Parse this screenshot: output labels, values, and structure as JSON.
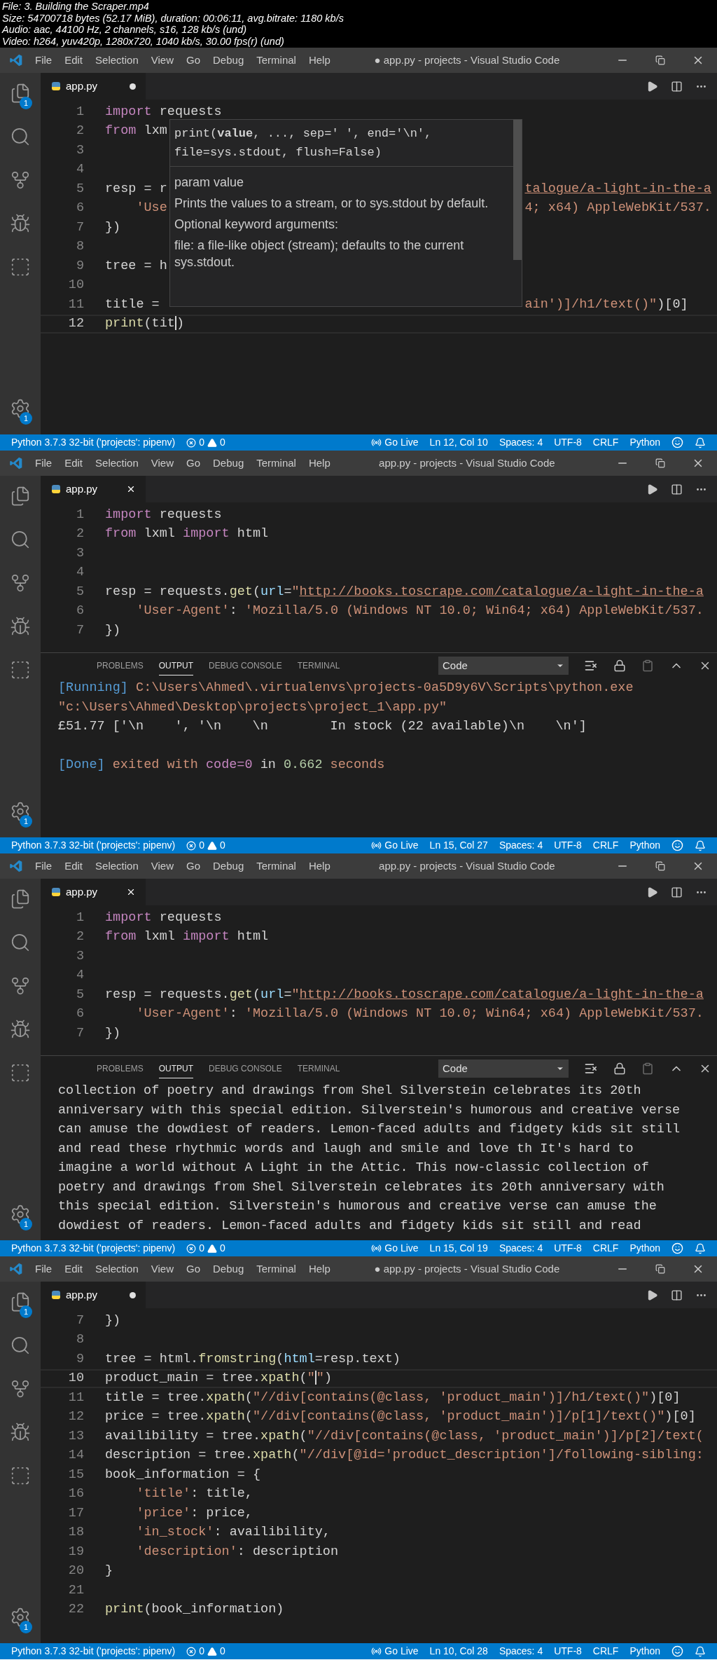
{
  "file_info": [
    "File: 3. Building the Scraper.mp4",
    "Size: 54700718 bytes (52.17 MiB), duration: 00:06:11, avg.bitrate: 1180 kb/s",
    "Audio: aac, 44100 Hz, 2 channels, s16, 128 kb/s (und)",
    "Video: h264, yuv420p, 1280x720, 1040 kb/s, 30.00 fps(r) (und)"
  ],
  "frames": [
    {
      "menu": [
        "File",
        "Edit",
        "Selection",
        "View",
        "Go",
        "Debug",
        "Terminal",
        "Help"
      ],
      "title": "● app.py - projects - Visual Studio Code",
      "explorer_badge": "1",
      "settings_badge": "1",
      "tab": {
        "label": "app.py",
        "dirty": true
      },
      "code": [
        {
          "number": "1",
          "current": false,
          "tokens": [
            {
              "text": "import",
              "kind": "kw"
            },
            {
              "text": " requests",
              "kind": "plain"
            }
          ]
        },
        {
          "number": "2",
          "current": false,
          "tokens": [
            {
              "text": "from",
              "kind": "kw"
            },
            {
              "text": " lxm",
              "kind": "plain"
            }
          ]
        },
        {
          "number": "3",
          "current": false
        },
        {
          "number": "4",
          "current": false
        },
        {
          "number": "5",
          "current": false,
          "tokens": [
            {
              "text": "resp = r",
              "kind": "plain"
            }
          ],
          "tail": [
            {
              "text": "talogue/a-light-in-the-a",
              "kind": "url"
            }
          ]
        },
        {
          "number": "6",
          "current": false,
          "tokens": [
            {
              "text": "    'Use",
              "kind": "str"
            }
          ],
          "tail": [
            {
              "text": "4; x64) AppleWebKit/537.",
              "kind": "str"
            }
          ]
        },
        {
          "number": "7",
          "current": false,
          "tokens": [
            {
              "text": "})",
              "kind": "plain"
            }
          ]
        },
        {
          "number": "8",
          "current": false
        },
        {
          "number": "9",
          "current": false,
          "tokens": [
            {
              "text": "tree = h",
              "kind": "plain"
            }
          ]
        },
        {
          "number": "10",
          "current": false
        },
        {
          "number": "11",
          "current": false,
          "tokens": [
            {
              "text": "title = ",
              "kind": "plain"
            }
          ],
          "tail": [
            {
              "text": "ain')]/h1/text()\"",
              "kind": "str"
            },
            {
              "text": ")[0]",
              "kind": "plain"
            }
          ]
        },
        {
          "number": "12",
          "current": true,
          "tokens": [
            {
              "text": "print",
              "kind": "fn"
            },
            {
              "text": "(tit",
              "kind": "plain"
            },
            {
              "kind": "cursor"
            },
            {
              "text": ")",
              "kind": "plain"
            }
          ]
        }
      ],
      "hover": {
        "signature": "print(**value**, ..., sep=' ', end='\\n', file=sys.stdout, flush=False)",
        "param": "param value",
        "description": [
          "Prints the values to a stream, or to sys.stdout by default.",
          "Optional keyword arguments:",
          "file:  a file-like object (stream); defaults to the current sys.stdout."
        ]
      },
      "status": {
        "interpreter": "Python 3.7.3 32-bit ('projects': pipenv)",
        "errors": "0",
        "warnings": "0",
        "go_live": "Go Live",
        "position": "Ln 12, Col 10",
        "spaces": "Spaces: 4",
        "encoding": "UTF-8",
        "eol": "CRLF",
        "language": "Python"
      }
    },
    {
      "menu": [
        "File",
        "Edit",
        "Selection",
        "View",
        "Go",
        "Debug",
        "Terminal",
        "Help"
      ],
      "title": "app.py - projects - Visual Studio Code",
      "settings_badge": "1",
      "tab": {
        "label": "app.py",
        "dirty": false
      },
      "code": [
        {
          "number": "1",
          "current": false,
          "tokens": [
            {
              "text": "import",
              "kind": "kw"
            },
            {
              "text": " requests",
              "kind": "plain"
            }
          ]
        },
        {
          "number": "2",
          "current": false,
          "tokens": [
            {
              "text": "from",
              "kind": "kw"
            },
            {
              "text": " lxml ",
              "kind": "plain"
            },
            {
              "text": "import",
              "kind": "kw"
            },
            {
              "text": " html",
              "kind": "plain"
            }
          ]
        },
        {
          "number": "3",
          "current": false
        },
        {
          "number": "4",
          "current": false
        },
        {
          "number": "5",
          "current": false,
          "tokens": [
            {
              "text": "resp = requests.",
              "kind": "plain"
            },
            {
              "text": "get",
              "kind": "fn"
            },
            {
              "text": "(",
              "kind": "plain"
            },
            {
              "text": "url",
              "kind": "param"
            },
            {
              "text": "=",
              "kind": "plain"
            },
            {
              "text": "\"",
              "kind": "str"
            },
            {
              "text": "http://books.toscrape.com/catalogue/a-light-in-the-a",
              "kind": "url"
            }
          ]
        },
        {
          "number": "6",
          "current": false,
          "tokens": [
            {
              "text": "    'User-Agent'",
              "kind": "str"
            },
            {
              "text": ": ",
              "kind": "plain"
            },
            {
              "text": "'Mozilla/5.0 (Windows NT 10.0; Win64; x64) AppleWebKit/537.",
              "kind": "str"
            }
          ]
        },
        {
          "number": "7",
          "current": false,
          "tokens": [
            {
              "text": "})",
              "kind": "plain"
            }
          ]
        }
      ],
      "panel": {
        "tabs": [
          {
            "label": "PROBLEMS",
            "selected": false
          },
          {
            "label": "OUTPUT",
            "selected": true
          },
          {
            "label": "DEBUG CONSOLE",
            "selected": false
          },
          {
            "label": "TERMINAL",
            "selected": false
          }
        ],
        "dropdown": "Code",
        "lines": [
          {
            "blank_before": false,
            "tokens": [
              {
                "text": "[Running]",
                "kind": "info"
              },
              {
                "text": " C:\\Users\\Ahmed\\.virtualenvs\\projects-0a5D9y6V\\Scripts\\python.exe",
                "kind": "str"
              }
            ]
          },
          {
            "blank_before": false,
            "tokens": [
              {
                "text": "\"c:\\Users\\Ahmed\\Desktop\\projects\\project_1\\app.py\"",
                "kind": "str"
              }
            ]
          },
          {
            "blank_before": false,
            "tokens": [
              {
                "text": "£51.77 ['\\n    ', '\\n    \\n        In stock (22 available)\\n    \\n']",
                "kind": "plain"
              }
            ]
          },
          {
            "blank_before": true,
            "tokens": [
              {
                "text": "[Done]",
                "kind": "info"
              },
              {
                "text": " exited with ",
                "kind": "str"
              },
              {
                "text": "code=0",
                "kind": "kw"
              },
              {
                "text": " in ",
                "kind": "plain"
              },
              {
                "text": "0.662",
                "kind": "num"
              },
              {
                "text": " seconds",
                "kind": "str"
              }
            ]
          }
        ]
      },
      "status": {
        "interpreter": "Python 3.7.3 32-bit ('projects': pipenv)",
        "errors": "0",
        "warnings": "0",
        "go_live": "Go Live",
        "position": "Ln 15, Col 27",
        "spaces": "Spaces: 4",
        "encoding": "UTF-8",
        "eol": "CRLF",
        "language": "Python"
      }
    },
    {
      "menu": [
        "File",
        "Edit",
        "Selection",
        "View",
        "Go",
        "Debug",
        "Terminal",
        "Help"
      ],
      "title": "app.py - projects - Visual Studio Code",
      "settings_badge": "1",
      "tab": {
        "label": "app.py",
        "dirty": false
      },
      "code": [
        {
          "number": "1",
          "current": false,
          "tokens": [
            {
              "text": "import",
              "kind": "kw"
            },
            {
              "text": " requests",
              "kind": "plain"
            }
          ]
        },
        {
          "number": "2",
          "current": false,
          "tokens": [
            {
              "text": "from",
              "kind": "kw"
            },
            {
              "text": " lxml ",
              "kind": "plain"
            },
            {
              "text": "import",
              "kind": "kw"
            },
            {
              "text": " html",
              "kind": "plain"
            }
          ]
        },
        {
          "number": "3",
          "current": false
        },
        {
          "number": "4",
          "current": false
        },
        {
          "number": "5",
          "current": false,
          "tokens": [
            {
              "text": "resp = requests.",
              "kind": "plain"
            },
            {
              "text": "get",
              "kind": "fn"
            },
            {
              "text": "(",
              "kind": "plain"
            },
            {
              "text": "url",
              "kind": "param"
            },
            {
              "text": "=",
              "kind": "plain"
            },
            {
              "text": "\"",
              "kind": "str"
            },
            {
              "text": "http://books.toscrape.com/catalogue/a-light-in-the-a",
              "kind": "url"
            }
          ]
        },
        {
          "number": "6",
          "current": false,
          "tokens": [
            {
              "text": "    'User-Agent'",
              "kind": "str"
            },
            {
              "text": ": ",
              "kind": "plain"
            },
            {
              "text": "'Mozilla/5.0 (Windows NT 10.0; Win64; x64) AppleWebKit/537.",
              "kind": "str"
            }
          ]
        },
        {
          "number": "7",
          "current": false,
          "tokens": [
            {
              "text": "})",
              "kind": "plain"
            }
          ]
        }
      ],
      "panel": {
        "tabs": [
          {
            "label": "PROBLEMS",
            "selected": false
          },
          {
            "label": "OUTPUT",
            "selected": true
          },
          {
            "label": "DEBUG CONSOLE",
            "selected": false
          },
          {
            "label": "TERMINAL",
            "selected": false
          }
        ],
        "dropdown": "Code",
        "lines": [
          {
            "blank_before": false,
            "tokens": [
              {
                "text": "collection of poetry and drawings from Shel Silverstein celebrates its 20th",
                "kind": "plain"
              }
            ]
          },
          {
            "blank_before": false,
            "tokens": [
              {
                "text": "anniversary with this special edition. Silverstein's humorous and creative verse",
                "kind": "plain"
              }
            ]
          },
          {
            "blank_before": false,
            "tokens": [
              {
                "text": "can amuse the dowdiest of readers. Lemon-faced adults and fidgety kids sit still",
                "kind": "plain"
              }
            ]
          },
          {
            "blank_before": false,
            "tokens": [
              {
                "text": "and read these rhythmic words and laugh and smile and love th It's hard to",
                "kind": "plain"
              }
            ]
          },
          {
            "blank_before": false,
            "tokens": [
              {
                "text": "imagine a world without A Light in the Attic. This now-classic collection of",
                "kind": "plain"
              }
            ]
          },
          {
            "blank_before": false,
            "tokens": [
              {
                "text": "poetry and drawings from Shel Silverstein celebrates its 20th anniversary with",
                "kind": "plain"
              }
            ]
          },
          {
            "blank_before": false,
            "tokens": [
              {
                "text": "this special edition. Silverstein's humorous and creative verse can amuse the",
                "kind": "plain"
              }
            ]
          },
          {
            "blank_before": false,
            "tokens": [
              {
                "text": "dowdiest of readers. Lemon-faced adults and fidgety kids sit still and read",
                "kind": "plain"
              }
            ]
          }
        ]
      },
      "status": {
        "interpreter": "Python 3.7.3 32-bit ('projects': pipenv)",
        "errors": "0",
        "warnings": "0",
        "go_live": "Go Live",
        "position": "Ln 15, Col 19",
        "spaces": "Spaces: 4",
        "encoding": "UTF-8",
        "eol": "CRLF",
        "language": "Python"
      }
    },
    {
      "menu": [
        "File",
        "Edit",
        "Selection",
        "View",
        "Go",
        "Debug",
        "Terminal",
        "Help"
      ],
      "title": "● app.py - projects - Visual Studio Code",
      "explorer_badge": "1",
      "settings_badge": "1",
      "tab": {
        "label": "app.py",
        "dirty": true
      },
      "code": [
        {
          "number": "7",
          "current": false,
          "tokens": [
            {
              "text": "})",
              "kind": "plain"
            }
          ]
        },
        {
          "number": "8",
          "current": false
        },
        {
          "number": "9",
          "current": false,
          "tokens": [
            {
              "text": "tree = html.",
              "kind": "plain"
            },
            {
              "text": "fromstring",
              "kind": "fn"
            },
            {
              "text": "(",
              "kind": "plain"
            },
            {
              "text": "html",
              "kind": "param"
            },
            {
              "text": "=resp.text)",
              "kind": "plain"
            }
          ]
        },
        {
          "number": "10",
          "current": true,
          "tokens": [
            {
              "text": "product_main = tree.",
              "kind": "plain"
            },
            {
              "text": "xpath",
              "kind": "fn"
            },
            {
              "text": "(",
              "kind": "plain"
            },
            {
              "text": "\"",
              "kind": "str"
            },
            {
              "kind": "cursor"
            },
            {
              "text": "\"",
              "kind": "str"
            },
            {
              "text": ")",
              "kind": "plain"
            }
          ]
        },
        {
          "number": "11",
          "current": false,
          "tokens": [
            {
              "text": "title = tree.",
              "kind": "plain"
            },
            {
              "text": "xpath",
              "kind": "fn"
            },
            {
              "text": "(",
              "kind": "plain"
            },
            {
              "text": "\"//div[contains(@class, 'product_main')]/h1/text()\"",
              "kind": "str"
            },
            {
              "text": ")[0]",
              "kind": "plain"
            }
          ]
        },
        {
          "number": "12",
          "current": false,
          "tokens": [
            {
              "text": "price = tree.",
              "kind": "plain"
            },
            {
              "text": "xpath",
              "kind": "fn"
            },
            {
              "text": "(",
              "kind": "plain"
            },
            {
              "text": "\"//div[contains(@class, 'product_main')]/p[1]/text()\"",
              "kind": "str"
            },
            {
              "text": ")[0]",
              "kind": "plain"
            }
          ]
        },
        {
          "number": "13",
          "current": false,
          "tokens": [
            {
              "text": "availibility = tree.",
              "kind": "plain"
            },
            {
              "text": "xpath",
              "kind": "fn"
            },
            {
              "text": "(",
              "kind": "plain"
            },
            {
              "text": "\"//div[contains(@class, 'product_main')]/p[2]/text(",
              "kind": "str"
            }
          ]
        },
        {
          "number": "14",
          "current": false,
          "tokens": [
            {
              "text": "description = tree.",
              "kind": "plain"
            },
            {
              "text": "xpath",
              "kind": "fn"
            },
            {
              "text": "(",
              "kind": "plain"
            },
            {
              "text": "\"//div[@id='product_description']/following-sibling:",
              "kind": "str"
            }
          ]
        },
        {
          "number": "15",
          "current": false,
          "tokens": [
            {
              "text": "book_information = {",
              "kind": "plain"
            }
          ]
        },
        {
          "number": "16",
          "current": false,
          "tokens": [
            {
              "text": "    'title'",
              "kind": "str"
            },
            {
              "text": ": title,",
              "kind": "plain"
            }
          ]
        },
        {
          "number": "17",
          "current": false,
          "tokens": [
            {
              "text": "    'price'",
              "kind": "str"
            },
            {
              "text": ": price,",
              "kind": "plain"
            }
          ]
        },
        {
          "number": "18",
          "current": false,
          "tokens": [
            {
              "text": "    'in_stock'",
              "kind": "str"
            },
            {
              "text": ": availibility,",
              "kind": "plain"
            }
          ]
        },
        {
          "number": "19",
          "current": false,
          "tokens": [
            {
              "text": "    'description'",
              "kind": "str"
            },
            {
              "text": ": description",
              "kind": "plain"
            }
          ]
        },
        {
          "number": "20",
          "current": false,
          "tokens": [
            {
              "text": "}",
              "kind": "plain"
            }
          ]
        },
        {
          "number": "21",
          "current": false
        },
        {
          "number": "22",
          "current": false,
          "tokens": [
            {
              "text": "print",
              "kind": "fn"
            },
            {
              "text": "(book_information)",
              "kind": "plain"
            }
          ]
        }
      ],
      "status": {
        "interpreter": "Python 3.7.3 32-bit ('projects': pipenv)",
        "errors": "0",
        "warnings": "0",
        "go_live": "Go Live",
        "position": "Ln 10, Col 28",
        "spaces": "Spaces: 4",
        "encoding": "UTF-8",
        "eol": "CRLF",
        "language": "Python"
      }
    }
  ]
}
